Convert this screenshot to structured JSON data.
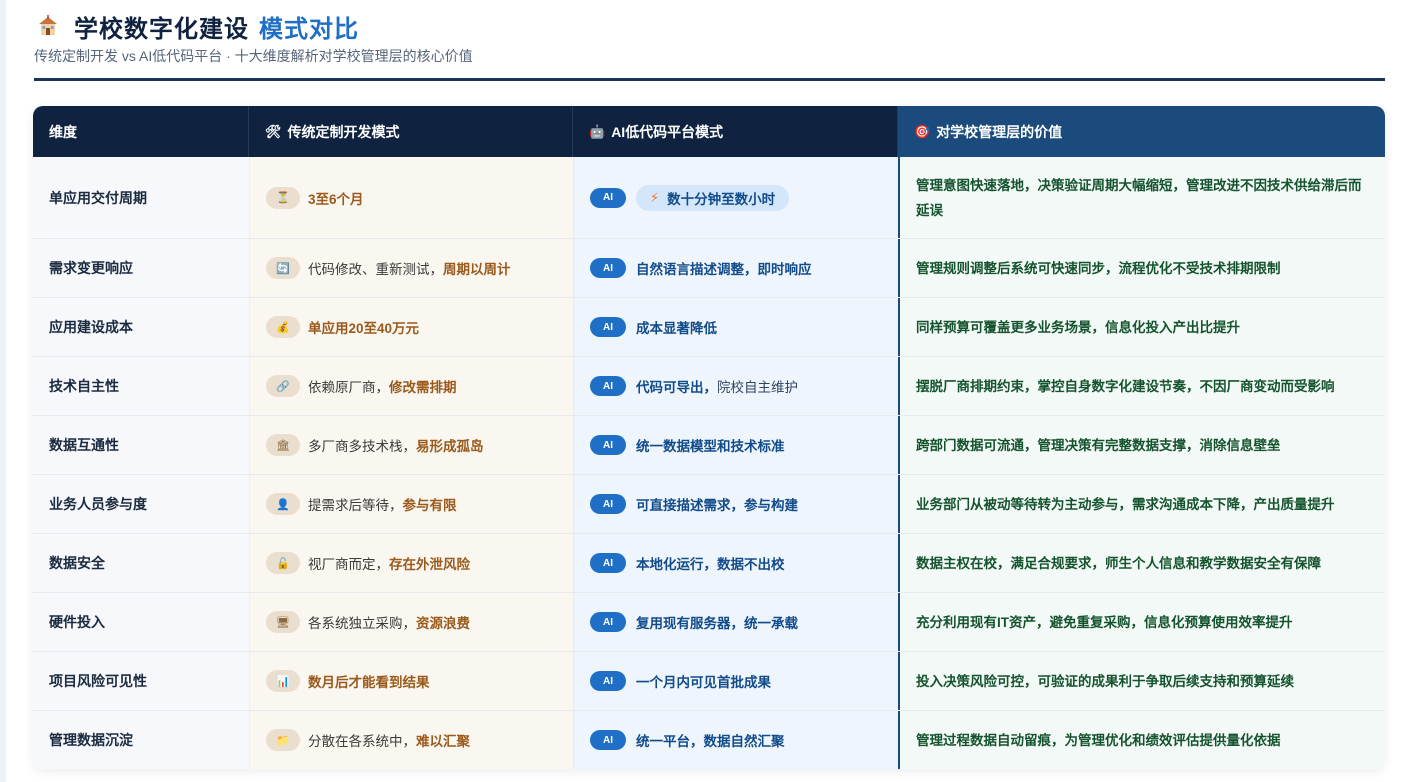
{
  "header": {
    "title_main": "学校数字化建设",
    "title_accent": "模式对比",
    "subtitle": "传统定制开发 vs AI低代码平台 · 十大维度解析对学校管理层的核心价值"
  },
  "table": {
    "headers": {
      "dimension": "维度",
      "traditional": "传统定制开发模式",
      "ai": "AI低代码平台模式",
      "value": "对学校管理层的价值"
    },
    "ai_badge": "AI",
    "rows": [
      {
        "dimension": "单应用交付周期",
        "trad_pre": "",
        "trad_hl": "3至6个月",
        "ai_main": "数十分钟至数小时",
        "ai_rest": "",
        "value": "管理意图快速落地，决策验证周期大幅缩短，管理改进不因技术供给滞后而延误"
      },
      {
        "dimension": "需求变更响应",
        "trad_pre": "代码修改、重新测试，",
        "trad_hl": "周期以周计",
        "ai_main": "自然语言描述调整，即时响应",
        "ai_rest": "",
        "value": "管理规则调整后系统可快速同步，流程优化不受技术排期限制"
      },
      {
        "dimension": "应用建设成本",
        "trad_pre": "",
        "trad_hl": "单应用20至40万元",
        "ai_main": "成本显著降低",
        "ai_rest": "",
        "value": "同样预算可覆盖更多业务场景，信息化投入产出比提升"
      },
      {
        "dimension": "技术自主性",
        "trad_pre": "依赖原厂商，",
        "trad_hl": "修改需排期",
        "ai_main": "代码可导出，",
        "ai_rest": "院校自主维护",
        "value": "摆脱厂商排期约束，掌控自身数字化建设节奏，不因厂商变动而受影响"
      },
      {
        "dimension": "数据互通性",
        "trad_pre": "多厂商多技术栈，",
        "trad_hl": "易形成孤岛",
        "ai_main": "统一数据模型和技术标准",
        "ai_rest": "",
        "value": "跨部门数据可流通，管理决策有完整数据支撑，消除信息壁垒"
      },
      {
        "dimension": "业务人员参与度",
        "trad_pre": "提需求后等待，",
        "trad_hl": "参与有限",
        "ai_main": "可直接描述需求，参与构建",
        "ai_rest": "",
        "value": "业务部门从被动等待转为主动参与，需求沟通成本下降，产出质量提升"
      },
      {
        "dimension": "数据安全",
        "trad_pre": "视厂商而定，",
        "trad_hl": "存在外泄风险",
        "ai_main": "本地化运行，数据不出校",
        "ai_rest": "",
        "value": "数据主权在校，满足合规要求，师生个人信息和教学数据安全有保障"
      },
      {
        "dimension": "硬件投入",
        "trad_pre": "各系统独立采购，",
        "trad_hl": "资源浪费",
        "ai_main": "复用现有服务器，统一承载",
        "ai_rest": "",
        "value": "充分利用现有IT资产，避免重复采购，信息化预算使用效率提升"
      },
      {
        "dimension": "项目风险可见性",
        "trad_pre": "",
        "trad_hl": "数月后才能看到结果",
        "ai_main": "一个月内可见首批成果",
        "ai_rest": "",
        "value": "投入决策风险可控，可验证的成果利于争取后续支持和预算延续"
      },
      {
        "dimension": "管理数据沉淀",
        "trad_pre": "分散在各系统中，",
        "trad_hl": "难以汇聚",
        "ai_main": "统一平台，数据自然汇聚",
        "ai_rest": "",
        "value": "管理过程数据自动留痕，为管理优化和绩效评估提供量化依据"
      }
    ]
  },
  "icons": {
    "title": "school-icon",
    "header_traditional": "tools-icon",
    "header_ai": "robot-icon",
    "header_value": "target-icon",
    "row_traditional": [
      "hourglass-icon",
      "refresh-icon",
      "money-bag-icon",
      "link-icon",
      "bank-icon",
      "person-icon",
      "unlock-icon",
      "computer-icon",
      "bar-chart-icon",
      "folder-icon"
    ],
    "row1_ai": "lightning-icon"
  },
  "colors": {
    "navy": "#0f2340",
    "accent_blue": "#1f6fc6",
    "value_green": "#14532d",
    "traditional_highlight": "#9a5a1c"
  }
}
